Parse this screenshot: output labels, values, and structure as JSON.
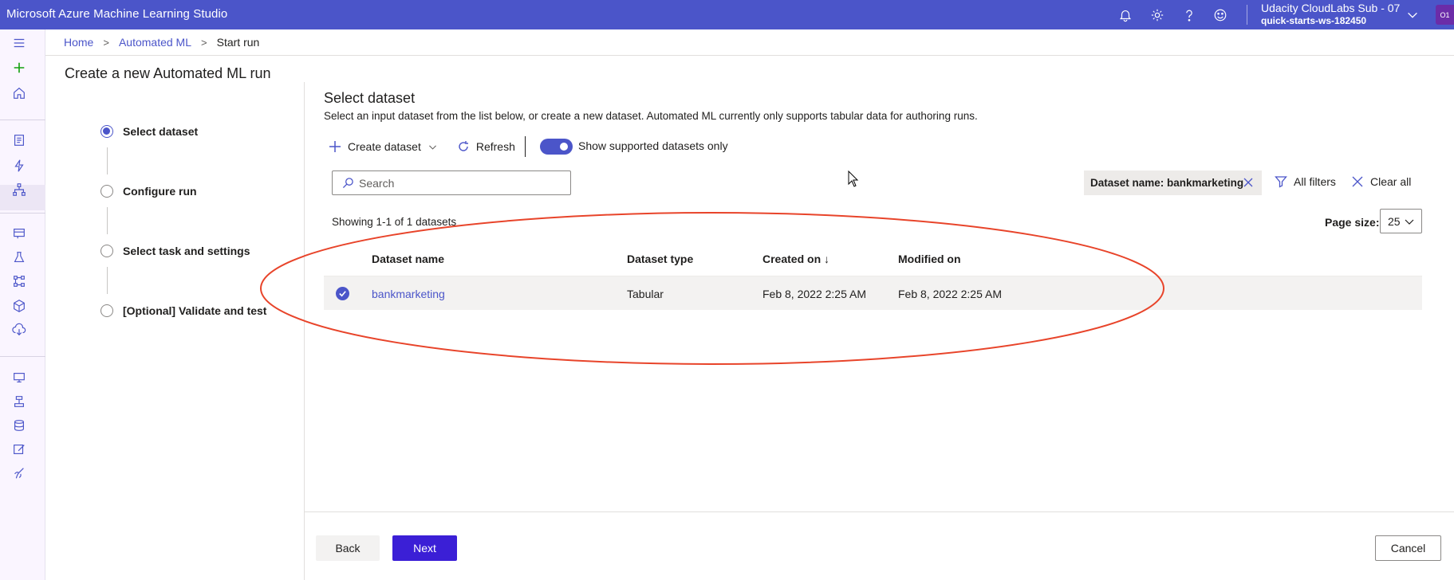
{
  "app": {
    "title": "Microsoft Azure Machine Learning Studio"
  },
  "account": {
    "subscription": "Udacity CloudLabs Sub - 07",
    "workspace": "quick-starts-ws-182450",
    "avatar_initials": "O1"
  },
  "colors": {
    "accent": "#4b55c9",
    "primary_button": "#3b1fd6",
    "annotation": "#e8442a"
  },
  "top_icons": [
    "bell-icon",
    "gear-icon",
    "help-icon",
    "smiley-icon",
    "chevron-down-icon"
  ],
  "rail_icons": [
    "menu-icon",
    "plus-icon",
    "home-icon",
    "notebook-icon",
    "automl-icon",
    "designer-icon",
    "data-icon",
    "jobs-icon",
    "pipelines-icon",
    "models-icon",
    "endpoints-icon",
    "compute-icon",
    "environments-icon",
    "datastores-icon",
    "labeling-icon",
    "linked-services-icon"
  ],
  "breadcrumb": {
    "home": "Home",
    "automl": "Automated ML",
    "current": "Start run"
  },
  "page_title": "Create a new Automated ML run",
  "steps": [
    {
      "label": "Select dataset",
      "active": true
    },
    {
      "label": "Configure run",
      "active": false
    },
    {
      "label": "Select task and settings",
      "active": false
    },
    {
      "label": "[Optional] Validate and test",
      "active": false
    }
  ],
  "section": {
    "title": "Select dataset",
    "description": "Select an input dataset from the list below, or create a new dataset. Automated ML currently only supports tabular data for authoring runs."
  },
  "toolbar": {
    "create_label": "Create dataset",
    "refresh_label": "Refresh",
    "toggle_label": "Show supported datasets only",
    "toggle_on": true
  },
  "search": {
    "placeholder": "Search",
    "value": ""
  },
  "filters": {
    "pill": "Dataset name: bankmarketing",
    "all_filters": "All filters",
    "clear_all": "Clear all"
  },
  "listing": {
    "showing": "Showing 1-1 of 1 datasets",
    "page_size_label": "Page size:",
    "page_size": "25"
  },
  "table": {
    "headers": [
      "Dataset name",
      "Dataset type",
      "Created on ↓",
      "Modified on"
    ],
    "rows": [
      {
        "name": "bankmarketing",
        "type": "Tabular",
        "created": "Feb 8, 2022 2:25 AM",
        "modified": "Feb 8, 2022 2:25 AM",
        "selected": true
      }
    ]
  },
  "footer": {
    "back": "Back",
    "next": "Next",
    "cancel": "Cancel"
  }
}
